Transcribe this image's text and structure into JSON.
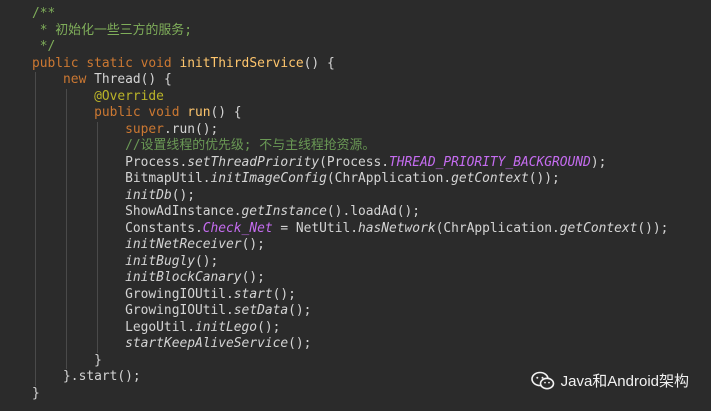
{
  "editor": {
    "lines": [
      [
        {
          "t": "/**",
          "c": "c-javadoc"
        }
      ],
      [
        {
          "t": " * 初始化一些三方的服务;",
          "c": "c-javadoc"
        }
      ],
      [
        {
          "t": " */",
          "c": "c-javadoc"
        }
      ],
      [
        {
          "t": "public static void ",
          "c": "c-kw"
        },
        {
          "t": "initThirdService",
          "c": "c-method"
        },
        {
          "t": "() {",
          "c": "c-plain"
        }
      ],
      [
        {
          "t": "    new ",
          "c": "c-kw"
        },
        {
          "t": "Thread() {",
          "c": "c-plain"
        }
      ],
      [
        {
          "t": "        @Override",
          "c": "c-anno"
        }
      ],
      [
        {
          "t": "        public void ",
          "c": "c-kw"
        },
        {
          "t": "run",
          "c": "c-method"
        },
        {
          "t": "() {",
          "c": "c-plain"
        }
      ],
      [
        {
          "t": "            super",
          "c": "c-kw"
        },
        {
          "t": ".run();",
          "c": "c-plain"
        }
      ],
      [
        {
          "t": "            //设置线程的优先级; 不与主线程抢资源。",
          "c": "c-comment"
        }
      ],
      [
        {
          "t": "            Process.",
          "c": "c-plain"
        },
        {
          "t": "setThreadPriority",
          "c": "c-italic"
        },
        {
          "t": "(Process.",
          "c": "c-plain"
        },
        {
          "t": "THREAD_PRIORITY_BACKGROUND",
          "c": "c-field"
        },
        {
          "t": ");",
          "c": "c-plain"
        }
      ],
      [
        {
          "t": "            BitmapUtil.",
          "c": "c-plain"
        },
        {
          "t": "initImageConfig",
          "c": "c-italic"
        },
        {
          "t": "(ChrApplication.",
          "c": "c-plain"
        },
        {
          "t": "getContext",
          "c": "c-italic"
        },
        {
          "t": "());",
          "c": "c-plain"
        }
      ],
      [
        {
          "t": "            ",
          "c": "c-plain"
        },
        {
          "t": "initDb",
          "c": "c-italic"
        },
        {
          "t": "();",
          "c": "c-plain"
        }
      ],
      [
        {
          "t": "            ShowAdInstance.",
          "c": "c-plain"
        },
        {
          "t": "getInstance",
          "c": "c-italic"
        },
        {
          "t": "().loadAd();",
          "c": "c-plain"
        }
      ],
      [
        {
          "t": "            Constants.",
          "c": "c-plain"
        },
        {
          "t": "Check_Net",
          "c": "c-field"
        },
        {
          "t": " = NetUtil.",
          "c": "c-plain"
        },
        {
          "t": "hasNetwork",
          "c": "c-italic"
        },
        {
          "t": "(ChrApplication.",
          "c": "c-plain"
        },
        {
          "t": "getContext",
          "c": "c-italic"
        },
        {
          "t": "());",
          "c": "c-plain"
        }
      ],
      [
        {
          "t": "            ",
          "c": "c-plain"
        },
        {
          "t": "initNetReceiver",
          "c": "c-italic"
        },
        {
          "t": "();",
          "c": "c-plain"
        }
      ],
      [
        {
          "t": "            ",
          "c": "c-plain"
        },
        {
          "t": "initBugly",
          "c": "c-italic"
        },
        {
          "t": "();",
          "c": "c-plain"
        }
      ],
      [
        {
          "t": "            ",
          "c": "c-plain"
        },
        {
          "t": "initBlockCanary",
          "c": "c-italic"
        },
        {
          "t": "();",
          "c": "c-plain"
        }
      ],
      [
        {
          "t": "            GrowingIOUtil.",
          "c": "c-plain"
        },
        {
          "t": "start",
          "c": "c-italic"
        },
        {
          "t": "();",
          "c": "c-plain"
        }
      ],
      [
        {
          "t": "            GrowingIOUtil.",
          "c": "c-plain"
        },
        {
          "t": "setData",
          "c": "c-italic"
        },
        {
          "t": "();",
          "c": "c-plain"
        }
      ],
      [
        {
          "t": "            LegoUtil.",
          "c": "c-plain"
        },
        {
          "t": "initLego",
          "c": "c-italic"
        },
        {
          "t": "();",
          "c": "c-plain"
        }
      ],
      [
        {
          "t": "            ",
          "c": "c-plain"
        },
        {
          "t": "startKeepAliveService",
          "c": "c-italic"
        },
        {
          "t": "();",
          "c": "c-plain"
        }
      ],
      [
        {
          "t": "        }",
          "c": "c-plain"
        }
      ],
      [
        {
          "t": "    }.start();",
          "c": "c-plain"
        }
      ],
      [
        {
          "t": "}",
          "c": "c-plain"
        }
      ]
    ]
  },
  "watermark": {
    "text": "Java和Android架构",
    "icon": "wechat-icon"
  }
}
